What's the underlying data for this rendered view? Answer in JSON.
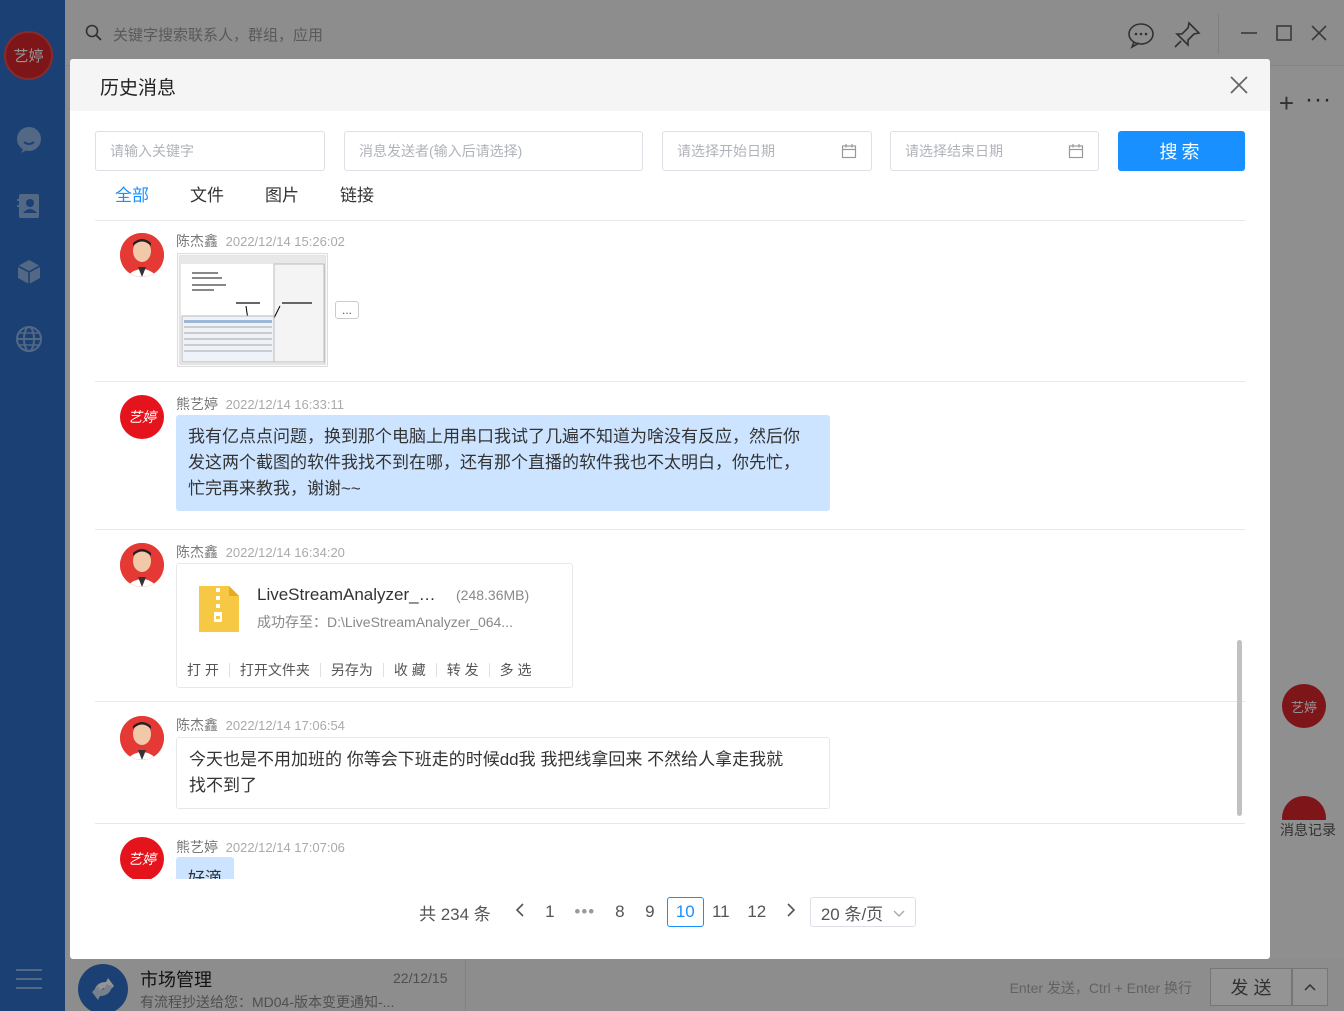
{
  "app": {
    "user_avatar": "艺婷",
    "search_placeholder": "关键字搜索联系人，群组，应用",
    "float_avatar": "艺婷",
    "history_link": "消息记录",
    "conversation": {
      "title": "市场管理",
      "date": "22/12/15",
      "preview": "有流程抄送给您：MD04-版本变更通知-..."
    },
    "input_hint": "Enter 发送，Ctrl + Enter 换行",
    "send_label": "发 送"
  },
  "modal": {
    "title": "历史消息",
    "filters": {
      "keyword_placeholder": "请输入关键字",
      "sender_placeholder": "消息发送者(输入后请选择)",
      "start_date_placeholder": "请选择开始日期",
      "end_date_placeholder": "请选择结束日期",
      "search_label": "搜索"
    },
    "tabs": [
      {
        "label": "全部",
        "active": true
      },
      {
        "label": "文件",
        "active": false
      },
      {
        "label": "图片",
        "active": false
      },
      {
        "label": "链接",
        "active": false
      }
    ],
    "messages": [
      {
        "sender": "陈杰鑫",
        "time": "2022/12/14 15:26:02",
        "type": "image",
        "more": "..."
      },
      {
        "sender": "熊艺婷",
        "avatar": "艺婷",
        "time": "2022/12/14 16:33:11",
        "type": "text",
        "line1": "我有亿点点问题，换到那个电脑上用串口我试了几遍不知道为啥没有反应，然后你",
        "line2": "发这两个截图的软件我找不到在哪，还有那个直播的软件我也不太明白，你先忙，",
        "line3": "忙完再来教我，谢谢~~"
      },
      {
        "sender": "陈杰鑫",
        "time": "2022/12/14 16:34:20",
        "type": "file",
        "file_name": "LiveStreamAnalyzer_064...",
        "file_size": "(248.36MB)",
        "file_path": "成功存至：D:\\LiveStreamAnalyzer_064...",
        "actions": [
          "打 开",
          "打开文件夹",
          "另存为",
          "收 藏",
          "转 发",
          "多 选"
        ]
      },
      {
        "sender": "陈杰鑫",
        "time": "2022/12/14 17:06:54",
        "type": "text",
        "line1": "今天也是不用加班的  你等会下班走的时候dd我  我把线拿回来  不然给人拿走我就",
        "line2": "找不到了"
      },
      {
        "sender": "熊艺婷",
        "avatar": "艺婷",
        "time": "2022/12/14 17:07:06",
        "type": "text",
        "line1": "好滴"
      }
    ],
    "pagination": {
      "total": "共 234 条",
      "pages": [
        "1",
        "8",
        "9",
        "10",
        "11",
        "12"
      ],
      "ellipsis": "•••",
      "current": "10",
      "page_size": "20 条/页"
    }
  }
}
